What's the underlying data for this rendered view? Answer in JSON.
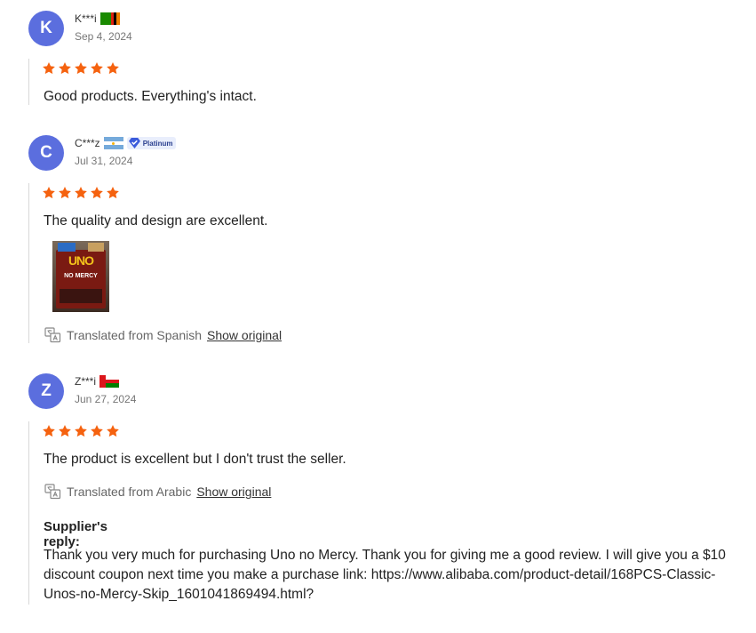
{
  "colors": {
    "avatar": "#5b6ede",
    "star": "#f5620f",
    "badge_bg": "#e9eefc",
    "badge_text": "#2a3f8f"
  },
  "reviews": [
    {
      "initial": "K",
      "user": "K***i",
      "flag": "zambia-flag",
      "date": "Sep 4, 2024",
      "rating": 5,
      "text": "Good products. Everything's intact."
    },
    {
      "initial": "C",
      "user": "C***z",
      "flag": "argentina-flag",
      "badge": "Platinum",
      "date": "Jul 31, 2024",
      "rating": 5,
      "text": "The quality and design are excellent.",
      "image_text": [
        "UNO",
        "NO MERCY"
      ],
      "translated_from": "Translated from Spanish",
      "show_original": "Show original"
    },
    {
      "initial": "Z",
      "user": "Z***i",
      "flag": "oman-flag",
      "date": "Jun 27, 2024",
      "rating": 5,
      "text": "The product is excellent but I don't trust the seller.",
      "translated_from": "Translated from Arabic",
      "show_original": "Show original",
      "reply_title": "Supplier's reply:",
      "reply_text": "Thank you very much for purchasing Uno no Mercy. Thank you for giving me a good review. I will give you a $10 discount coupon next time you make a purchase link:  https://www.alibaba.com/product-detail/168PCS-Classic-Unos-no-Mercy-Skip_1601041869494.html?"
    }
  ]
}
